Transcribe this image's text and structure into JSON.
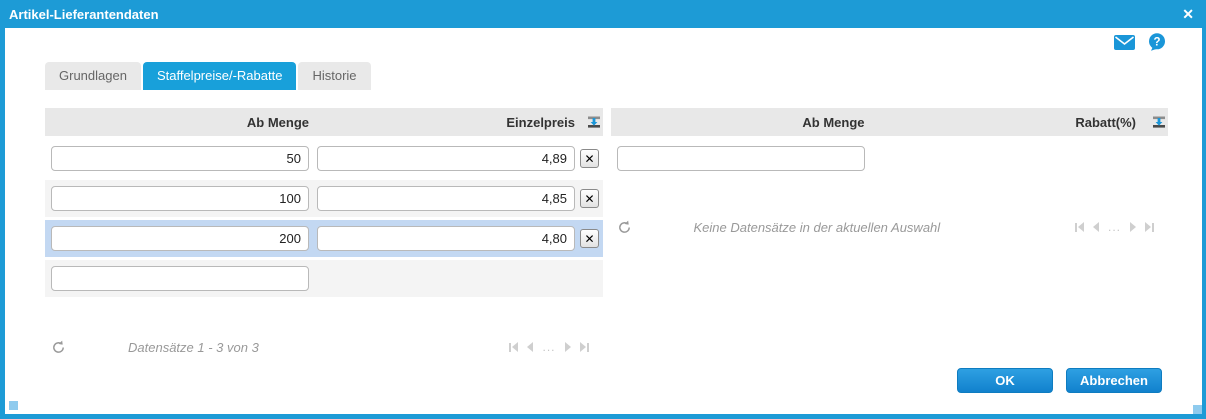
{
  "dialog": {
    "title": "Artikel-Lieferantendaten"
  },
  "icons": {
    "close_glyph": "✕",
    "delete_glyph": "✕",
    "help_glyph": "?"
  },
  "tabs": [
    {
      "label": "Grundlagen",
      "active": false
    },
    {
      "label": "Staffelpreise/-Rabatte",
      "active": true
    },
    {
      "label": "Historie",
      "active": false
    }
  ],
  "left_table": {
    "columns": [
      "Ab Menge",
      "Einzelpreis"
    ],
    "rows": [
      {
        "ab_menge": "50",
        "einzelpreis": "4,89",
        "selected": false
      },
      {
        "ab_menge": "100",
        "einzelpreis": "4,85",
        "selected": false
      },
      {
        "ab_menge": "200",
        "einzelpreis": "4,80",
        "selected": true
      }
    ],
    "new_row": {
      "ab_menge": ""
    },
    "status": "Datensätze 1 - 3 von 3"
  },
  "right_table": {
    "columns": [
      "Ab Menge",
      "Rabatt(%)"
    ],
    "rows": [],
    "new_row": {
      "ab_menge": ""
    },
    "status": "Keine Datensätze in der aktuellen Auswahl"
  },
  "pagination": {
    "ellipsis": "..."
  },
  "buttons": {
    "ok": "OK",
    "cancel": "Abbrechen"
  },
  "colors": {
    "accent_blue": "#1d9bd6",
    "active_tab_blue": "#18a0da",
    "selected_row_blue": "#c3d8f2",
    "button_blue": "#1181cd",
    "header_gray": "#e8e8e8",
    "stripe_gray": "#f4f4f4"
  }
}
